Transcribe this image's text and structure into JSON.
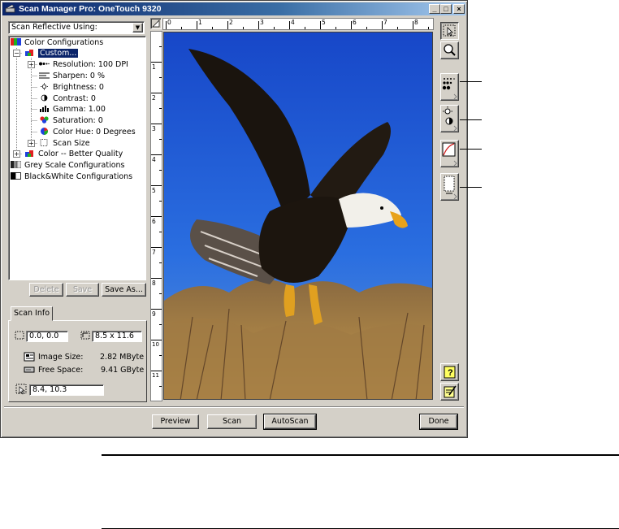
{
  "window": {
    "title": "Scan Manager Pro: OneTouch 9320",
    "min_label": "_",
    "max_label": "□",
    "close_label": "×"
  },
  "left_panel": {
    "scan_source": "Scan Reflective Using:",
    "tree": {
      "color_configs": "Color Configurations",
      "custom": "Custom...",
      "resolution": "Resolution: 100 DPI",
      "sharpen": "Sharpen: 0 %",
      "brightness": "Brightness: 0",
      "contrast": "Contrast: 0",
      "gamma": "Gamma: 1.00",
      "saturation": "Saturation: 0",
      "color_hue": "Color Hue: 0 Degrees",
      "scan_size": "Scan Size",
      "better_quality": "Color -- Better Quality",
      "grey_scale": "Grey Scale Configurations",
      "bw": "Black&White Configurations"
    },
    "buttons": {
      "delete": "Delete",
      "save": "Save",
      "save_as": "Save As..."
    },
    "scan_info": {
      "tab_label": "Scan Info",
      "origin": "0.0, 0.0",
      "size": "8.5 x 11.6",
      "image_size_label": "Image Size:",
      "image_size_value": "2.82 MByte",
      "free_space_label": "Free Space:",
      "free_space_value": "9.41 GByte",
      "cursor": "8.4, 10.3"
    }
  },
  "rulers": {
    "top_numbers": [
      "0",
      "1",
      "2",
      "3",
      "4",
      "5",
      "6",
      "7",
      "8"
    ],
    "left_numbers": [
      "1",
      "2",
      "3",
      "4",
      "5",
      "6",
      "7",
      "8",
      "9",
      "10",
      "11"
    ]
  },
  "bottom_buttons": {
    "preview": "Preview",
    "scan": "Scan",
    "autoscan": "AutoScan",
    "done": "Done"
  },
  "colors": {
    "title_bar": "#0a246a",
    "window_face": "#d4d0c8",
    "selection": "#0a246a",
    "sky": "#1f5fd6"
  }
}
